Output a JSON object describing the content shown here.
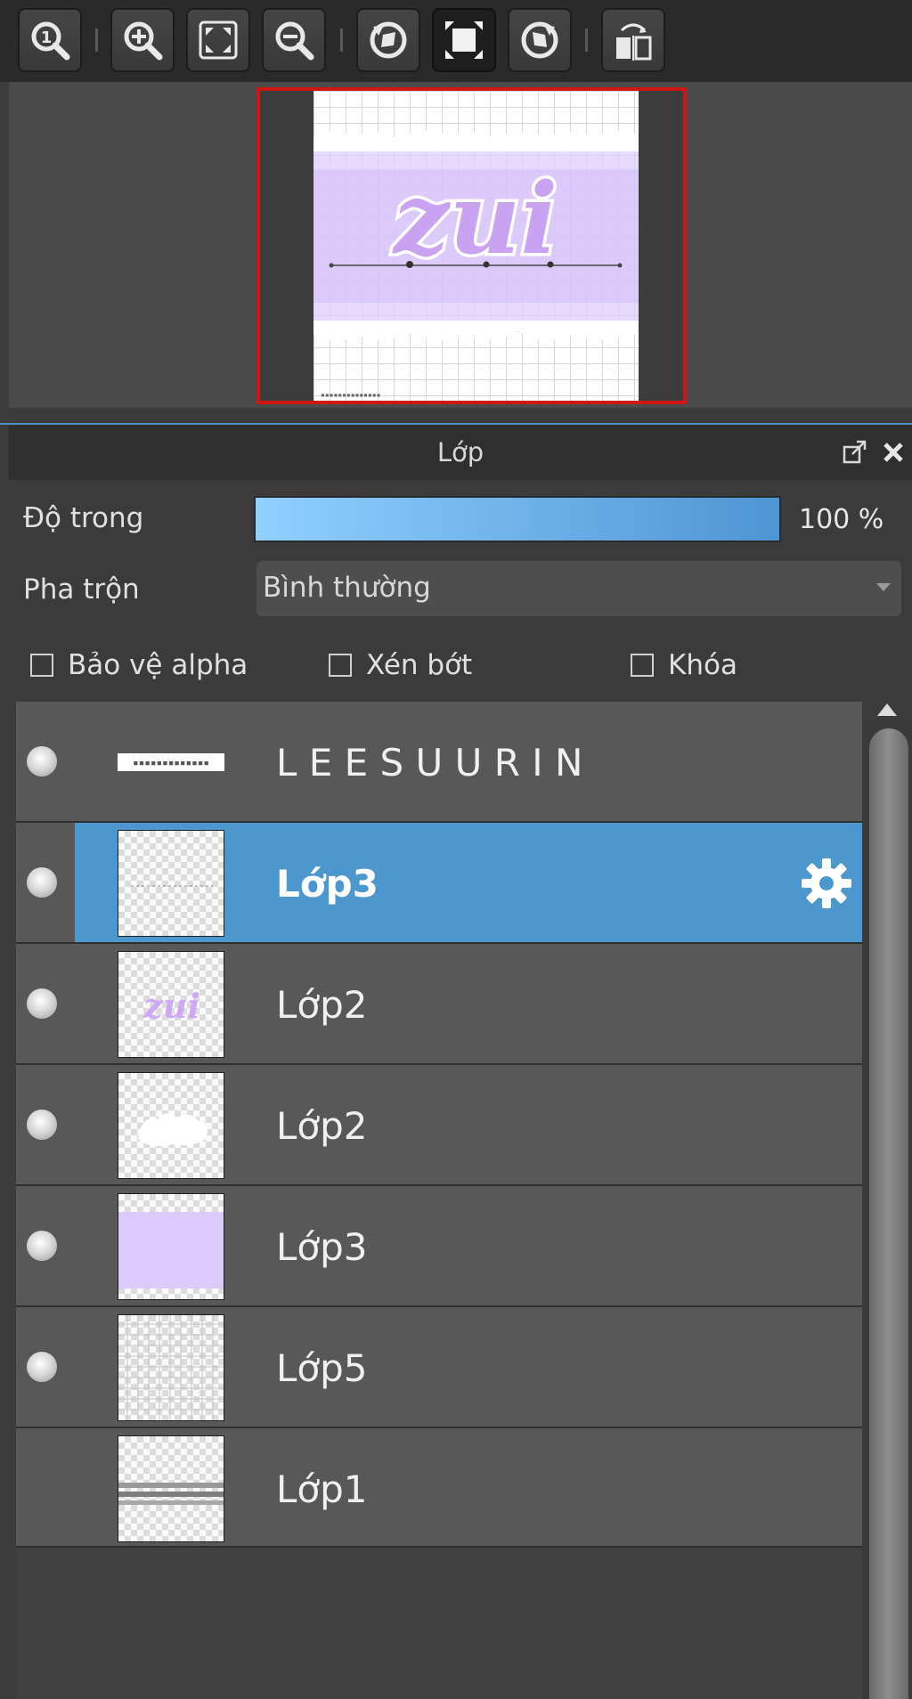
{
  "toolbar": {
    "buttons": [
      {
        "name": "zoom-actual-size",
        "icon": "magnifier-one-icon"
      },
      {
        "name": "zoom-in",
        "icon": "zoom-in-icon"
      },
      {
        "name": "fit-to-window",
        "icon": "fit-screen-icon"
      },
      {
        "name": "zoom-out",
        "icon": "zoom-out-icon"
      },
      {
        "name": "rotate-left",
        "icon": "rotate-left-icon"
      },
      {
        "name": "reset-view",
        "icon": "frame-icon"
      },
      {
        "name": "rotate-right",
        "icon": "rotate-right-icon"
      },
      {
        "name": "flip-horizontal",
        "icon": "flip-icon"
      }
    ]
  },
  "navigator": {
    "preview_text": "zui",
    "highlight_color": "#d01515"
  },
  "panel": {
    "title": "Lớp",
    "opacity_label": "Độ trong",
    "opacity_value": "100 %",
    "opacity_fraction": 1.0,
    "blend_label": "Pha trộn",
    "blend_value": "Bình thường",
    "checkboxes": [
      {
        "label": "Bảo vệ alpha",
        "checked": false
      },
      {
        "label": "Xén bớt",
        "checked": false
      },
      {
        "label": "Khóa",
        "checked": false
      }
    ]
  },
  "layers": [
    {
      "name": "L E E S U U R I N",
      "visible": true,
      "selected": false,
      "thumb": "text-strip"
    },
    {
      "name": "Lớp3",
      "visible": true,
      "selected": true,
      "thumb": "dotted-line"
    },
    {
      "name": "Lớp2",
      "visible": true,
      "selected": false,
      "thumb": "zui-text"
    },
    {
      "name": "Lớp2",
      "visible": true,
      "selected": false,
      "thumb": "white-shape"
    },
    {
      "name": "Lớp3",
      "visible": true,
      "selected": false,
      "thumb": "lavender-fill"
    },
    {
      "name": "Lớp5",
      "visible": true,
      "selected": false,
      "thumb": "grid"
    },
    {
      "name": "Lớp1",
      "visible": false,
      "selected": false,
      "thumb": "bands"
    }
  ],
  "colors": {
    "selection": "#4d97cf",
    "accent": "#4d8fc8",
    "lavender": "#dccafc"
  }
}
